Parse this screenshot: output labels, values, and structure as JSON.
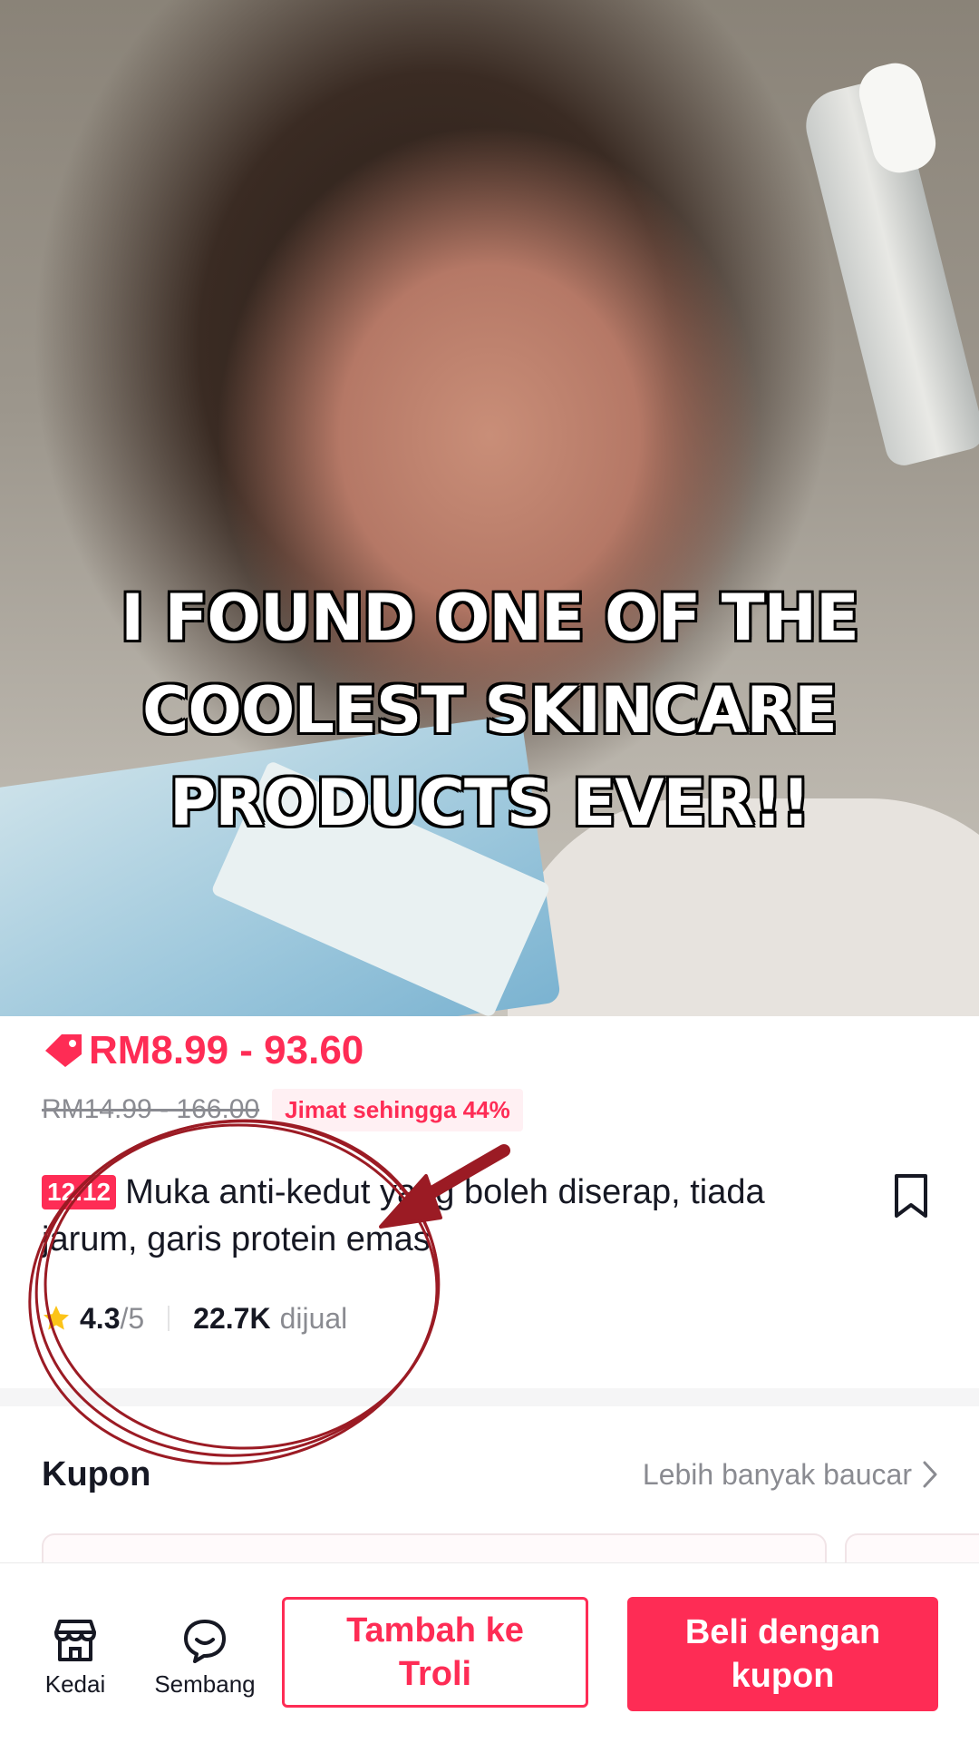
{
  "video": {
    "caption_lines": [
      "I FOUND ONE OF THE",
      "COOLEST SKINCARE",
      "PRODUCTS EVER!!"
    ]
  },
  "product": {
    "price_range": "RM8.99 - 93.60",
    "original_price": "RM14.99 - 166.00",
    "savings_badge": "Jimat sehingga 44%",
    "promo_tag": "12.12",
    "title": "Muka anti-kedut yang boleh diserap, tiada jarum, garis protein emas",
    "rating": "4.3",
    "rating_max": "/5",
    "sold_count": "22.7K",
    "sold_label": "dijual"
  },
  "coupons": {
    "heading": "Kupon",
    "more_link": "Lebih banyak baucar"
  },
  "bottom_bar": {
    "shop_label": "Kedai",
    "chat_label": "Sembang",
    "add_to_cart_label": "Tambah ke Troli",
    "buy_label": "Beli dengan kupon"
  },
  "colors": {
    "accent": "#fe2c55",
    "annotation": "#9b1b24",
    "muted_text": "#8a8b91"
  },
  "icons": [
    "price-tag-icon",
    "bookmark-icon",
    "star-icon",
    "chevron-right-icon",
    "store-icon",
    "chat-bubble-icon"
  ]
}
